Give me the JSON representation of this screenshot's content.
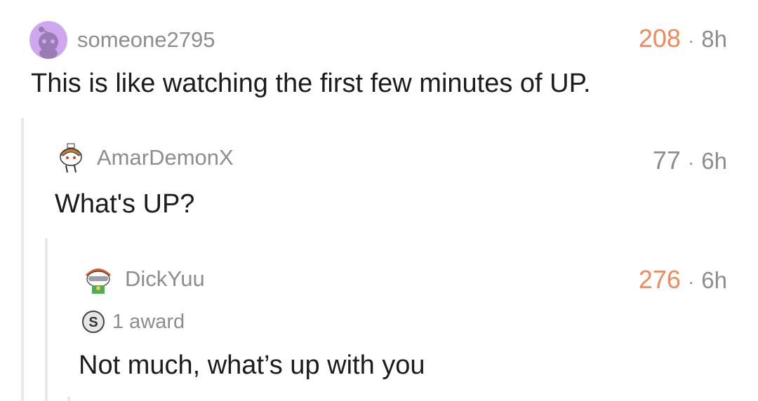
{
  "comments": [
    {
      "username": "someone2795",
      "score": "208",
      "separator": "·",
      "time": "8h",
      "body": "This is like watching the first few minutes of UP."
    },
    {
      "username": "AmarDemonX",
      "score": "77",
      "separator": "·",
      "time": "6h",
      "body": "What's UP?"
    },
    {
      "username": "DickYuu",
      "score": "276",
      "separator": "·",
      "time": "6h",
      "award": "1 award",
      "body": "Not much, what’s up with you"
    }
  ],
  "colors": {
    "score_hot": "#ef8a5c",
    "score_normal": "#8d8d8d",
    "muted_text": "#8d8d8d",
    "body_text": "#1c1c1c",
    "thread_line": "#e9e9e9",
    "avatar_purple": "#cfa6f0"
  },
  "icons": [
    "snoo-avatar-icon",
    "snoo-avatar-icon",
    "snoo-avatar-icon",
    "silver-award-icon"
  ]
}
